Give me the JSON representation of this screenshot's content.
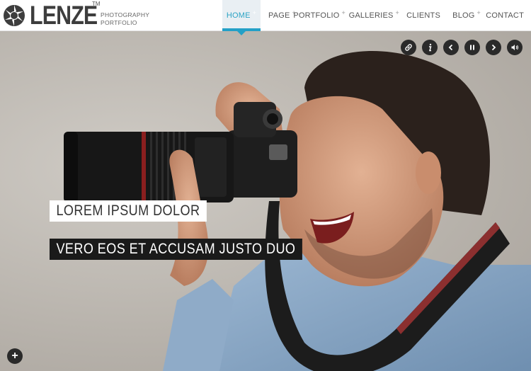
{
  "header": {
    "logo_text": "LENZE",
    "logo_tm": "TM",
    "tagline_line1": "PHOTOGRAPHY",
    "tagline_line2": "PORTFOLIO"
  },
  "nav": {
    "items": [
      {
        "label": "HOME",
        "has_submenu": true,
        "active": true
      },
      {
        "label": "PAGE",
        "has_submenu": true
      },
      {
        "label": "PORTFOLIO",
        "has_submenu": true
      },
      {
        "label": "GALLERIES",
        "has_submenu": true
      },
      {
        "label": "CLIENTS",
        "has_submenu": false
      },
      {
        "label": "BLOG",
        "has_submenu": true
      },
      {
        "label": "CONTACT",
        "has_submenu": false
      }
    ],
    "submenu_marker": "+"
  },
  "slider": {
    "controls": [
      "link-icon",
      "info-icon",
      "prev-icon",
      "pause-icon",
      "next-icon",
      "volume-icon"
    ],
    "caption_primary": "LOREM IPSUM DOLOR",
    "caption_secondary": "VERO EOS ET ACCUSAM JUSTO DUO",
    "expand_label": "+"
  },
  "colors": {
    "accent": "#23a0c7",
    "nav_active_bg": "#e9eff3",
    "control_bg": "#2a2a2a"
  }
}
